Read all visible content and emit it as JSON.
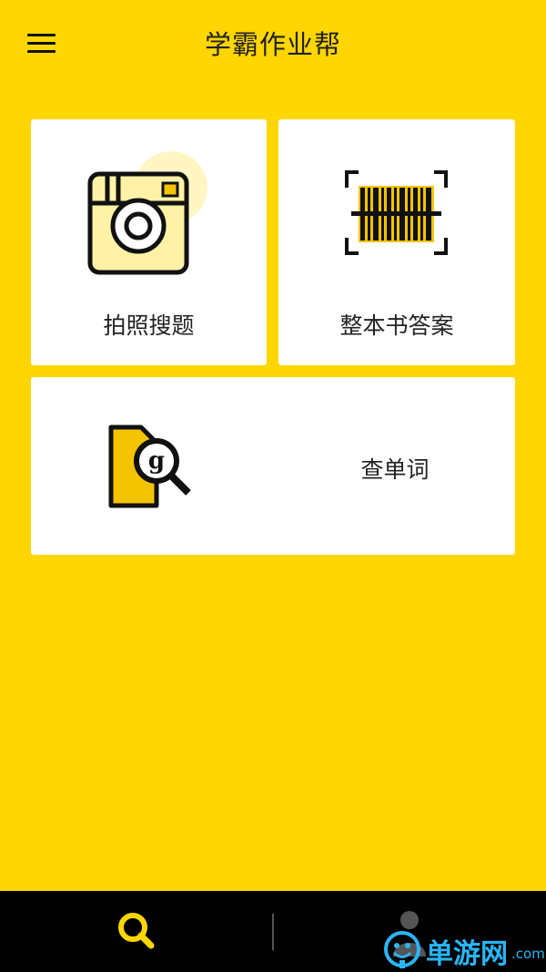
{
  "header": {
    "title": "学霸作业帮"
  },
  "cards": {
    "photo_search": {
      "label": "拍照搜题",
      "icon": "camera-icon"
    },
    "book_answers": {
      "label": "整本书答案",
      "icon": "barcode-scan-icon"
    },
    "word_lookup": {
      "label": "查单词",
      "icon": "dictionary-search-icon"
    }
  },
  "tabbar": {
    "search_icon": "search-icon",
    "profile_icon": "user-icon"
  },
  "watermark": {
    "text": "单游网",
    "suffix": ".com"
  },
  "colors": {
    "background": "#FFD600",
    "card": "#FFFFFF",
    "tabbar": "#000000",
    "accent": "#FFD600",
    "icon_dark": "#111111",
    "icon_light_yellow": "#FFF2A6",
    "watermark": "#29B6F6"
  }
}
